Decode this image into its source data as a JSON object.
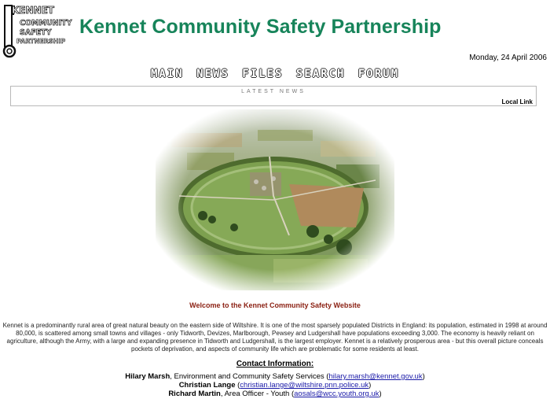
{
  "header": {
    "logo_lines": [
      "KENNET",
      "COMMUNITY",
      "SAFETY",
      "PARTNERSHIP"
    ],
    "title": "Kennet Community Safety Partnership",
    "date": "Monday, 24 April 2006"
  },
  "nav": {
    "items": [
      "MAIN",
      "NEWS",
      "FILES",
      "SEARCH",
      "FORUM"
    ]
  },
  "news": {
    "heading": "LATEST NEWS",
    "local_link": "Local Link"
  },
  "main": {
    "welcome": "Welcome to the Kennet Community Safety Website",
    "intro": "Kennet is a predominantly rural area of great natural beauty on the eastern side of Wiltshire. It is one of the most sparsely populated Districts in England: its population, estimated in 1998 at around 80,000, is scattered among small towns and villages - only Tidworth, Devizes, Marlborough, Pewsey and Ludgershall have populations exceeding 3,000. The economy is heavily reliant on agriculture, although the Army, with a large and expanding presence in Tidworth and Ludgershall, is the largest employer. Kennet is a relatively prosperous area - but this overall picture conceals pockets of deprivation, and aspects of community life which are problematic for some residents at least."
  },
  "contact": {
    "heading": "Contact Information:",
    "people": [
      {
        "name": "Hilary Marsh",
        "role": ", Environment and Community Safety Services (",
        "email": "hilary.marsh@kennet.gov.uk",
        "suffix": ")"
      },
      {
        "name": "Christian Lange",
        "role": " (",
        "email": "christian.lange@wiltshire.pnn.police.uk",
        "suffix": ")"
      },
      {
        "name": "Richard Martin",
        "role": ", Area Officer - Youth (",
        "email": "aosals@wcc.youth.org.uk",
        "suffix": ")"
      }
    ]
  },
  "colors": {
    "title": "#17845a",
    "welcome": "#8a1f11",
    "link": "#1a1aa8"
  }
}
